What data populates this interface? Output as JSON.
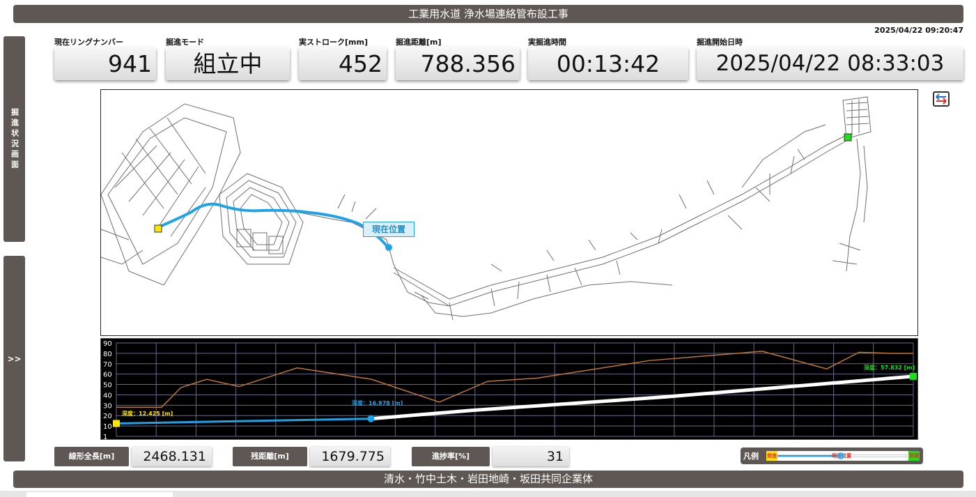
{
  "header": {
    "title": "工業用水道 浄水場連絡管布設工事",
    "datetime": "2025/04/22 09:20:47"
  },
  "side_tabs": {
    "status_screen": "掘進状況画面",
    "expand": ">>"
  },
  "metrics": [
    {
      "label": "現在リングナンバー",
      "value": "941"
    },
    {
      "label": "掘進モード",
      "value": "組立中"
    },
    {
      "label": "実ストローク[mm]",
      "value": "452"
    },
    {
      "label": "掘進距離[m]",
      "value": "788.356"
    },
    {
      "label": "実掘進時間",
      "value": "00:13:42"
    },
    {
      "label": "掘進開始日時",
      "value": "2025/04/22 08:33:03"
    }
  ],
  "map": {
    "current_position_label": "現在位置"
  },
  "profile": {
    "start_depth_label": "深度：12.425 [m]",
    "current_depth_label": "深度：16.978 [m]",
    "end_depth_label": "深度：57.832 [m]",
    "y_ticks": [
      "90",
      "80",
      "70",
      "60",
      "50",
      "40",
      "30",
      "20",
      "10",
      "1"
    ]
  },
  "chart_data": {
    "type": "line",
    "ylim": [
      0,
      90
    ],
    "xlim": [
      0,
      2468.131
    ],
    "series": [
      {
        "name": "driven",
        "color": "#1fa3e8",
        "x": [
          0,
          788.356
        ],
        "y": [
          12.425,
          16.978
        ]
      },
      {
        "name": "planned",
        "color": "#ffffff",
        "x": [
          788.356,
          1100,
          1700,
          2468.131
        ],
        "y": [
          16.978,
          25,
          38,
          57.832
        ]
      },
      {
        "name": "ground",
        "color": "#c07830",
        "x": [
          0,
          140,
          200,
          280,
          380,
          560,
          790,
          1000,
          1150,
          1300,
          1650,
          2000,
          2200,
          2300,
          2400,
          2468.131
        ],
        "y": [
          28,
          28,
          47,
          55,
          48,
          66,
          55,
          33,
          53,
          56,
          73,
          82,
          65,
          81,
          80,
          80
        ]
      }
    ],
    "markers": [
      {
        "x": 0,
        "y": 12.425,
        "color": "#ffe600"
      },
      {
        "x": 788.356,
        "y": 16.978,
        "color": "#1fa3e8"
      },
      {
        "x": 2468.131,
        "y": 57.832,
        "color": "#19e019"
      }
    ]
  },
  "stats": [
    {
      "label": "線形全長[m]",
      "value": "2468.131"
    },
    {
      "label": "残距離[m]",
      "value": "1679.775"
    },
    {
      "label": "進捗率[%]",
      "value": "31"
    }
  ],
  "legend": {
    "title": "凡例",
    "start": "発進",
    "current": "現在位置",
    "end": "到達"
  },
  "colors": {
    "bar": "#5e5753",
    "driven": "#1fa3e8",
    "start_marker": "#ffe600",
    "end_marker": "#19e019"
  },
  "footer": {
    "company": "清水・竹中土木・岩田地崎・坂田共同企業体"
  }
}
